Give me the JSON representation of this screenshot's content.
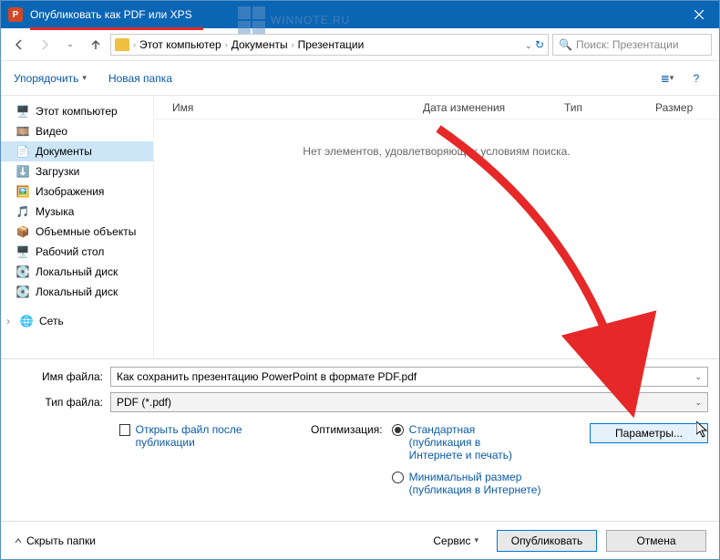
{
  "titlebar": {
    "title": "Опубликовать как PDF или XPS"
  },
  "nav": {
    "crumbs": [
      "Этот компьютер",
      "Документы",
      "Презентации"
    ],
    "search_placeholder": "Поиск: Презентации"
  },
  "toolbar": {
    "organize": "Упорядочить",
    "new_folder": "Новая папка"
  },
  "sidebar": {
    "items": [
      {
        "icon": "🖥️",
        "label": "Этот компьютер"
      },
      {
        "icon": "🎞️",
        "label": "Видео"
      },
      {
        "icon": "📄",
        "label": "Документы",
        "selected": true
      },
      {
        "icon": "⬇️",
        "label": "Загрузки"
      },
      {
        "icon": "🖼️",
        "label": "Изображения"
      },
      {
        "icon": "🎵",
        "label": "Музыка"
      },
      {
        "icon": "📦",
        "label": "Объемные объекты"
      },
      {
        "icon": "🖥️",
        "label": "Рабочий стол"
      },
      {
        "icon": "💽",
        "label": "Локальный диск"
      },
      {
        "icon": "💽",
        "label": "Локальный диск"
      }
    ],
    "network": {
      "icon": "🌐",
      "label": "Сеть"
    }
  },
  "columns": {
    "name": "Имя",
    "date": "Дата изменения",
    "type": "Тип",
    "size": "Размер"
  },
  "empty_message": "Нет элементов, удовлетворяющих условиям поиска.",
  "form": {
    "filename_label": "Имя файла:",
    "filename_value": "Как сохранить презентацию PowerPoint в формате PDF.pdf",
    "filetype_label": "Тип файла:",
    "filetype_value": "PDF (*.pdf)",
    "open_after": "Открыть файл после публикации",
    "optimization_label": "Оптимизация:",
    "opt_standard": "Стандартная (публикация в Интернете и печать)",
    "opt_minimal": "Минимальный размер (публикация в Интернете)",
    "params_button": "Параметры..."
  },
  "footer": {
    "hide_folders": "Скрыть папки",
    "tools": "Сервис",
    "publish": "Опубликовать",
    "cancel": "Отмена"
  },
  "watermark": "WINNOTE.RU"
}
